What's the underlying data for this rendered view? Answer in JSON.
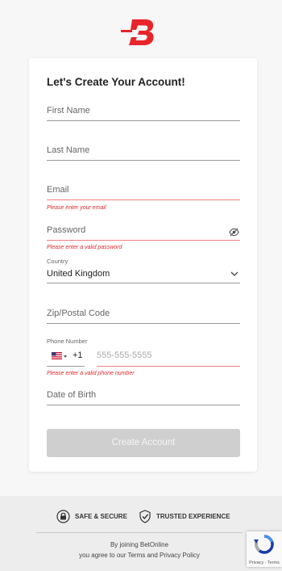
{
  "brand": {
    "logo_letter": "B",
    "brand_color": "#e8242b"
  },
  "form": {
    "title": "Let's Create Your Account!",
    "first_name_placeholder": "First Name",
    "last_name_placeholder": "Last Name",
    "email_placeholder": "Email",
    "email_error": "Please enter your email",
    "password_placeholder": "Password",
    "password_error": "Please enter a valid password",
    "country_label": "Country",
    "country_value": "United Kingdom",
    "zip_placeholder": "Zip/Postal Code",
    "phone_label": "Phone Number",
    "phone_dial_code": "+1",
    "phone_placeholder": "555-555-5555",
    "phone_error": "Please enter a valid phone number",
    "dob_placeholder": "Date of Birth",
    "submit_label": "Create Account"
  },
  "footer": {
    "badge_secure": "SAFE & SECURE",
    "badge_trusted": "TRUSTED EXPERIENCE",
    "line1": "By joining BetOnline",
    "line2": "you agree to our Terms and Privacy Policy"
  },
  "recaptcha": {
    "label": "Privacy - Terms"
  },
  "colors": {
    "error": "#e0282d",
    "error_underline": "#f08080",
    "button_disabled": "#cfcfcf"
  }
}
